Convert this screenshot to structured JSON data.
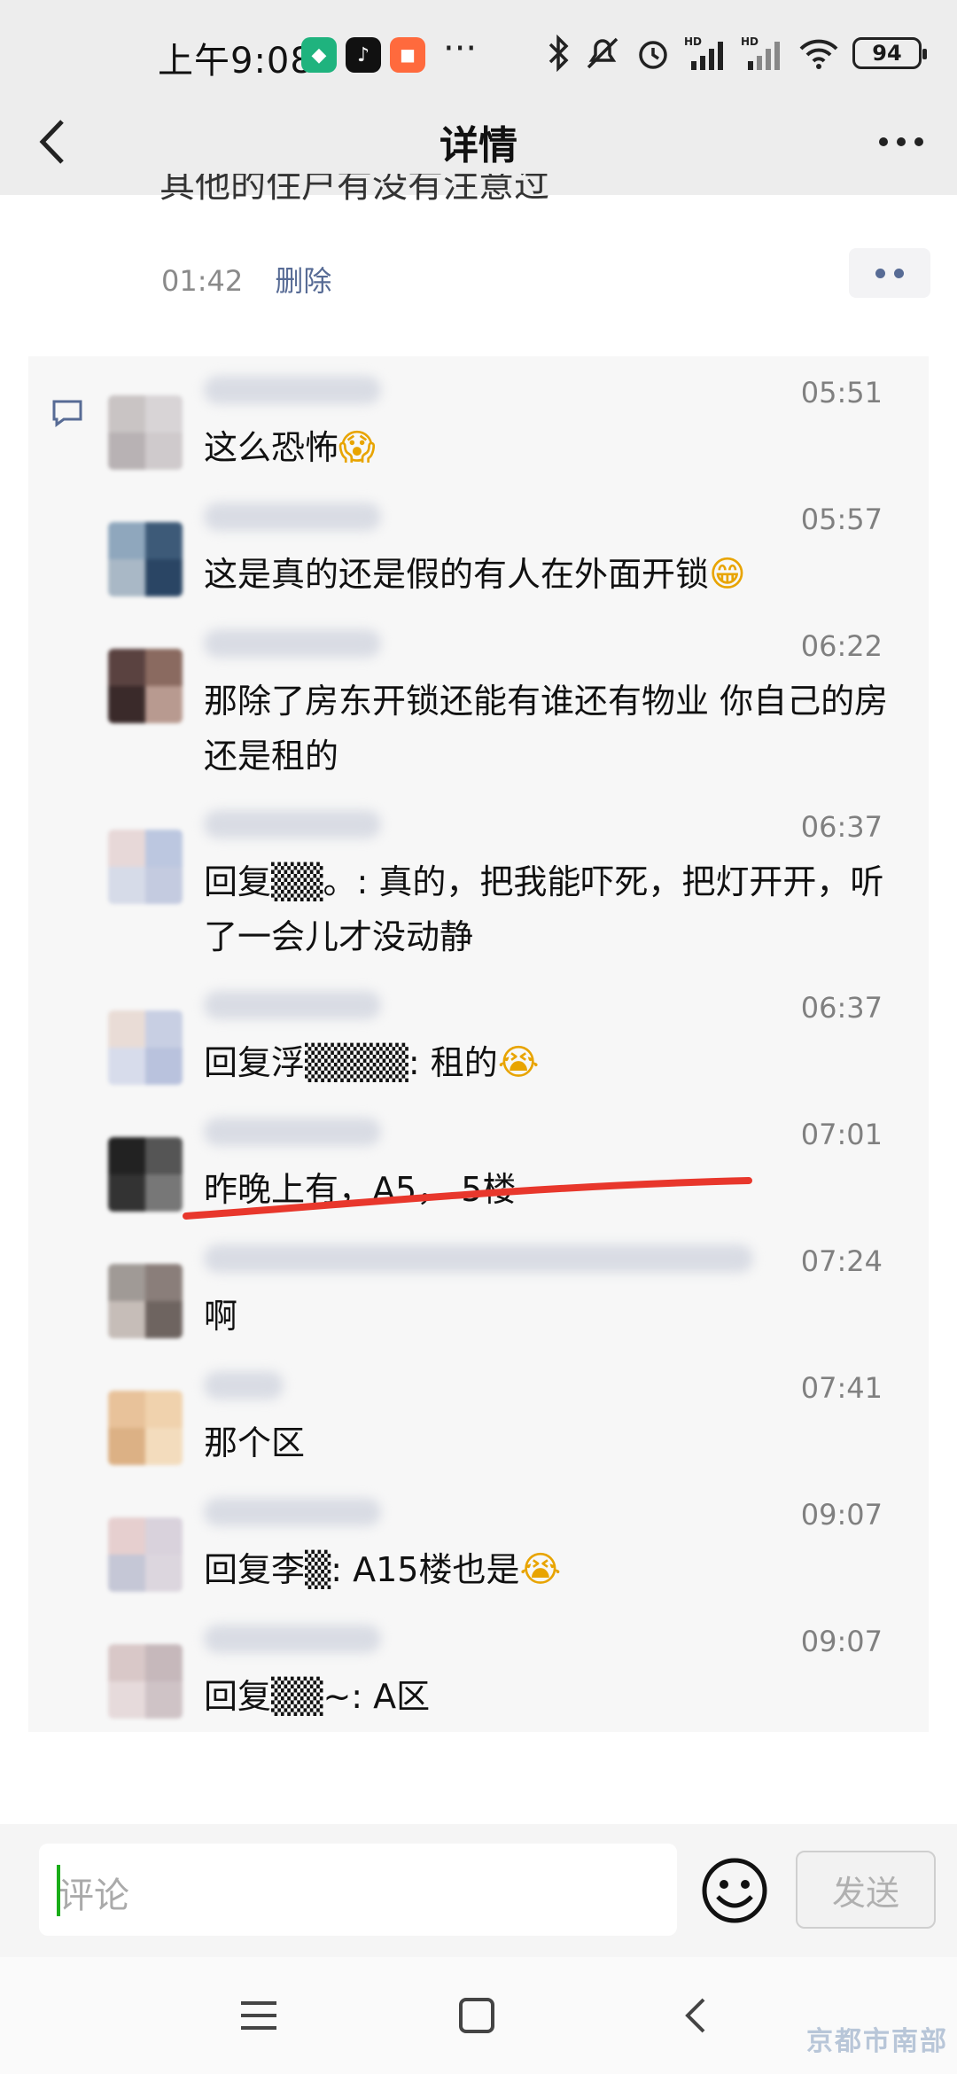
{
  "status_bar": {
    "time": "上午9:08",
    "dots": "···",
    "battery": "94"
  },
  "navbar": {
    "title": "详情"
  },
  "post": {
    "clipped_text": "其他的住户有没有注意过",
    "time": "01:42",
    "delete_label": "删除"
  },
  "comments": [
    {
      "time": "05:51",
      "text": "这么恐怖",
      "emoji": "😱"
    },
    {
      "time": "05:57",
      "text": "这是真的还是假的有人在外面开锁",
      "emoji": "😁"
    },
    {
      "time": "06:22",
      "text": "那除了房东开锁还能有谁还有物业 你自己的房还是租的",
      "emoji": ""
    },
    {
      "time": "06:37",
      "text": "回复▒▒。: 真的，把我能吓死，把灯开开，听了一会儿才没动静",
      "emoji": ""
    },
    {
      "time": "06:37",
      "text": "回复浮▒▒▒▒: 租的",
      "emoji": "😭"
    },
    {
      "time": "07:01",
      "text": "昨晚上有，A5， 5楼",
      "emoji": ""
    },
    {
      "time": "07:24",
      "text": "啊",
      "emoji": ""
    },
    {
      "time": "07:41",
      "text": "那个区",
      "emoji": ""
    },
    {
      "time": "09:07",
      "text": "回复李▒: A15楼也是",
      "emoji": "😭"
    },
    {
      "time": "09:07",
      "text": "回复▒▒~: A区",
      "emoji": ""
    }
  ],
  "input_bar": {
    "placeholder": "评论",
    "send_label": "发送"
  },
  "watermark": "京都市南部"
}
